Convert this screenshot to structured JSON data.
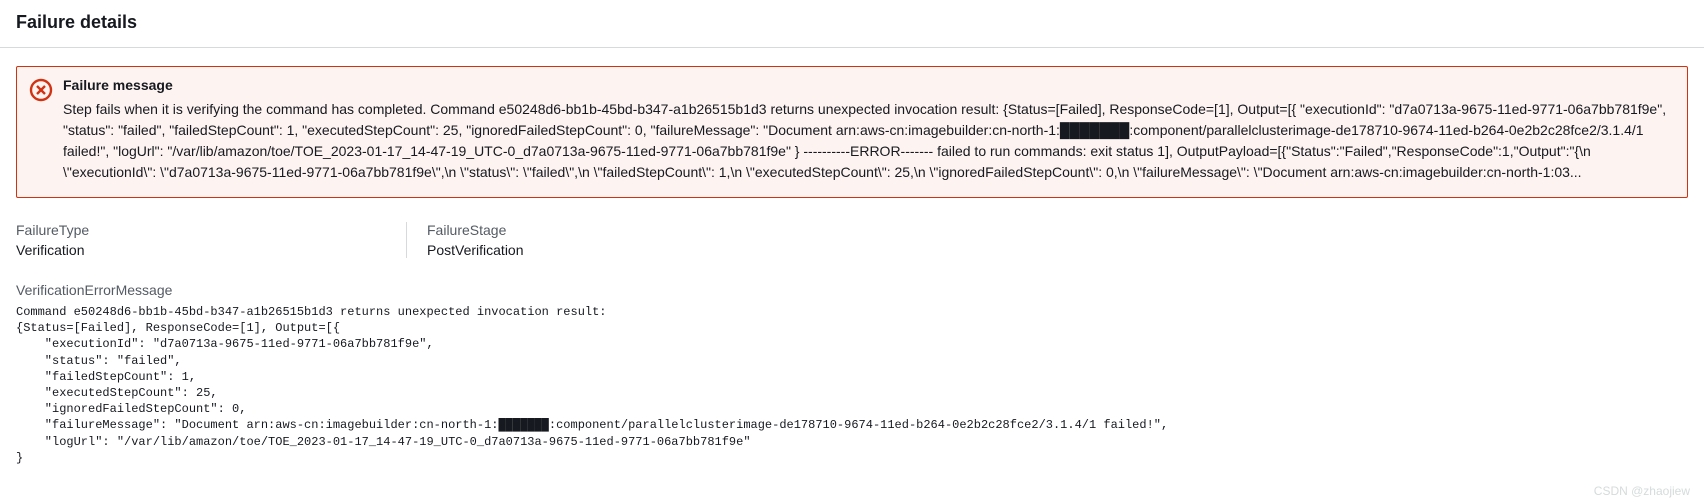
{
  "header": {
    "title": "Failure details"
  },
  "alert": {
    "title": "Failure message",
    "body": "Step fails when it is verifying the command has completed. Command e50248d6-bb1b-45bd-b347-a1b26515b1d3 returns unexpected invocation result: {Status=[Failed], ResponseCode=[1], Output=[{ \"executionId\": \"d7a0713a-9675-11ed-9771-06a7bb781f9e\", \"status\": \"failed\", \"failedStepCount\": 1, \"executedStepCount\": 25, \"ignoredFailedStepCount\": 0, \"failureMessage\": \"Document arn:aws-cn:imagebuilder:cn-north-1:███████:component/parallelclusterimage-de178710-9674-11ed-b264-0e2b2c28fce2/3.1.4/1 failed!\", \"logUrl\": \"/var/lib/amazon/toe/TOE_2023-01-17_14-47-19_UTC-0_d7a0713a-9675-11ed-9771-06a7bb781f9e\" } ----------ERROR------- failed to run commands: exit status 1], OutputPayload=[{\"Status\":\"Failed\",\"ResponseCode\":1,\"Output\":\"{\\n \\\"executionId\\\": \\\"d7a0713a-9675-11ed-9771-06a7bb781f9e\\\",\\n \\\"status\\\": \\\"failed\\\",\\n \\\"failedStepCount\\\": 1,\\n \\\"executedStepCount\\\": 25,\\n \\\"ignoredFailedStepCount\\\": 0,\\n \\\"failureMessage\\\": \\\"Document arn:aws-cn:imagebuilder:cn-north-1:03..."
  },
  "details": {
    "failureType": {
      "label": "FailureType",
      "value": "Verification"
    },
    "failureStage": {
      "label": "FailureStage",
      "value": "PostVerification"
    },
    "verificationErrorMessage": {
      "label": "VerificationErrorMessage",
      "body": "Command e50248d6-bb1b-45bd-b347-a1b26515b1d3 returns unexpected invocation result:\n{Status=[Failed], ResponseCode=[1], Output=[{\n    \"executionId\": \"d7a0713a-9675-11ed-9771-06a7bb781f9e\",\n    \"status\": \"failed\",\n    \"failedStepCount\": 1,\n    \"executedStepCount\": 25,\n    \"ignoredFailedStepCount\": 0,\n    \"failureMessage\": \"Document arn:aws-cn:imagebuilder:cn-north-1:███████:component/parallelclusterimage-de178710-9674-11ed-b264-0e2b2c28fce2/3.1.4/1 failed!\",\n    \"logUrl\": \"/var/lib/amazon/toe/TOE_2023-01-17_14-47-19_UTC-0_d7a0713a-9675-11ed-9771-06a7bb781f9e\"\n}"
    }
  },
  "watermark": "CSDN @zhaojiew"
}
